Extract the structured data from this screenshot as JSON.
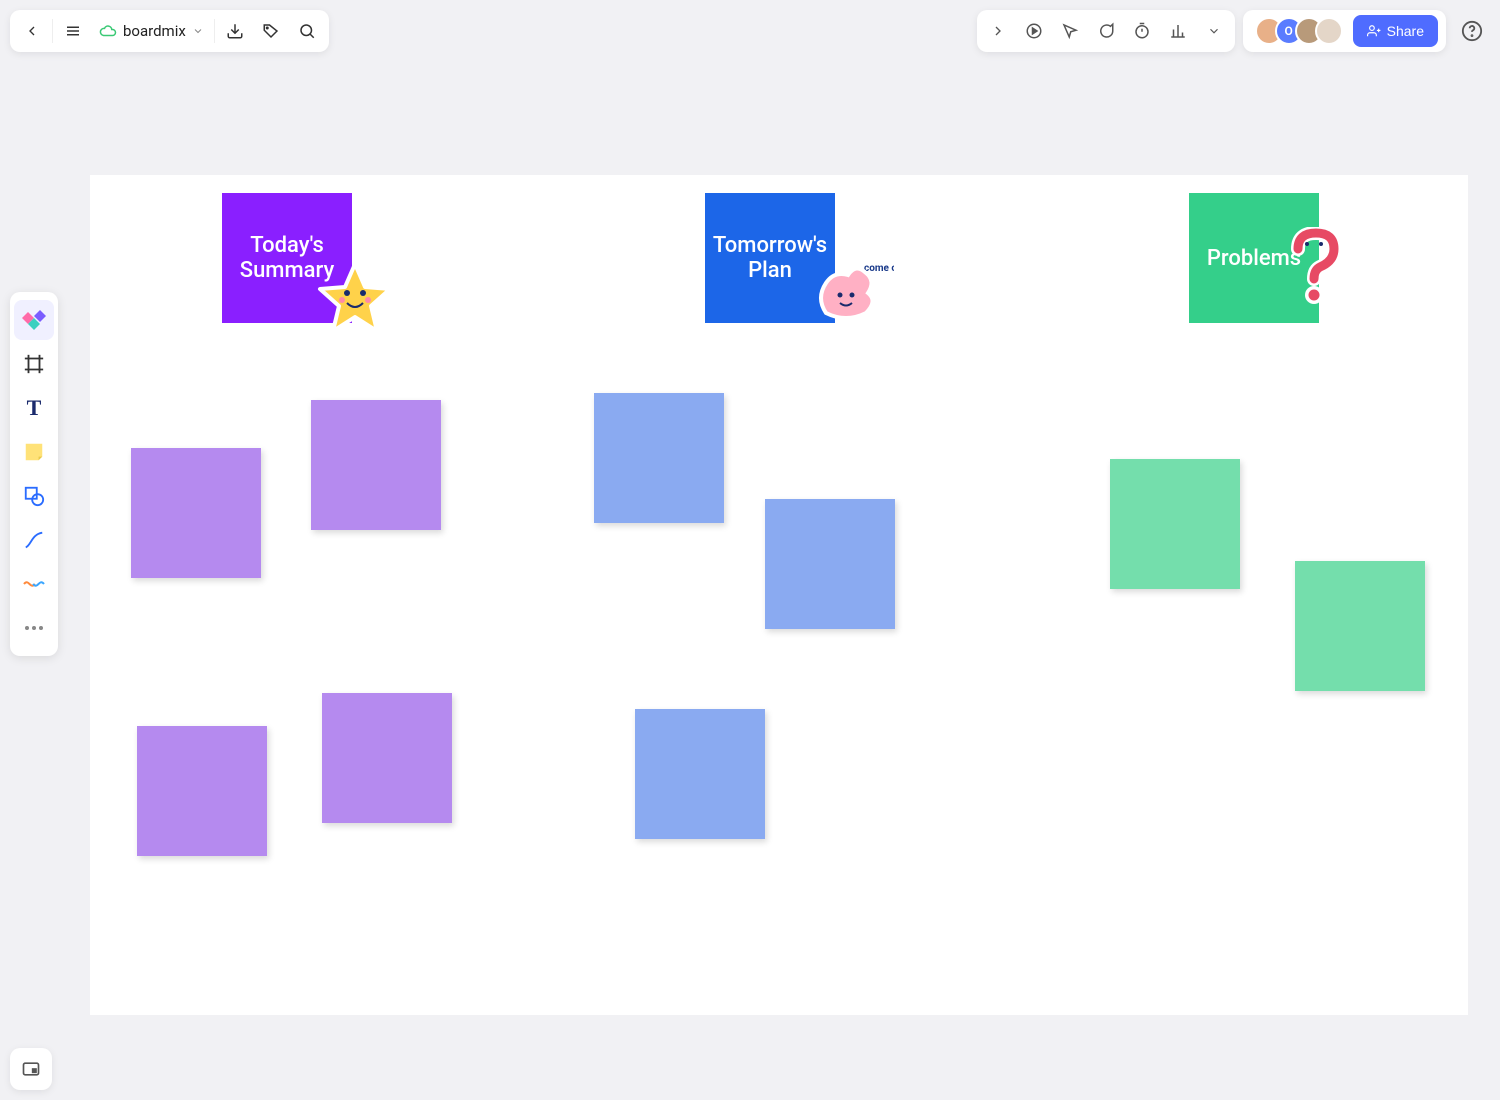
{
  "header": {
    "brand": "boardmix",
    "share_label": "Share"
  },
  "avatars": [
    {
      "bg": "#e8b088",
      "initial": ""
    },
    {
      "bg": "#5a7cff",
      "initial": "O"
    },
    {
      "bg": "#8a7a5a",
      "initial": ""
    },
    {
      "bg": "#e0d0c0",
      "initial": ""
    }
  ],
  "cards": {
    "today": "Today's Summary",
    "tomorrow": "Tomorrow's Plan",
    "problems": "Problems"
  },
  "sticker_text": {
    "come_on": "come on"
  }
}
